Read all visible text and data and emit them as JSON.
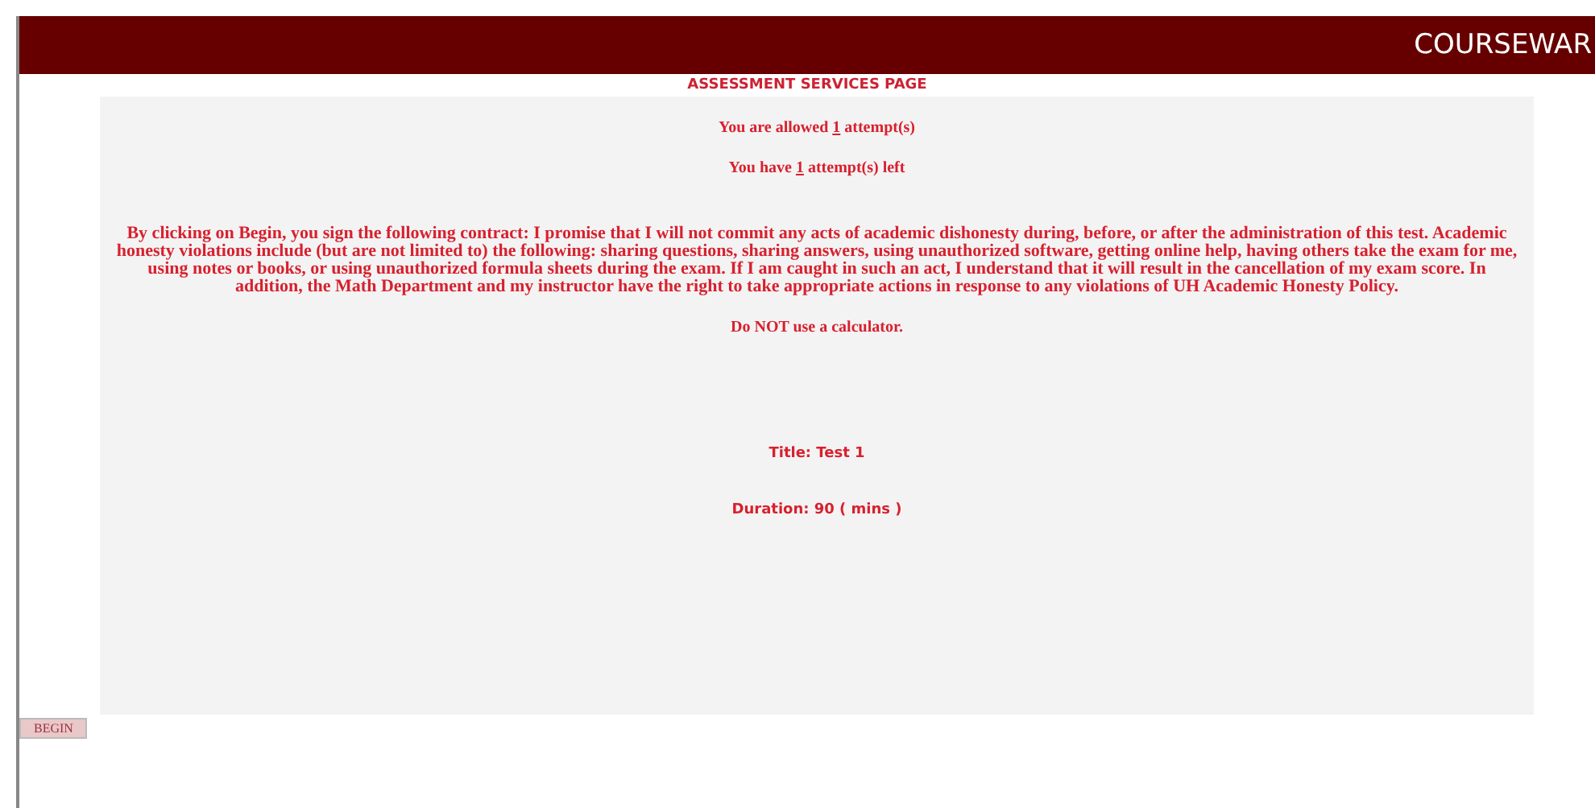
{
  "header": {
    "brand": "COURSEWAR"
  },
  "page_title": "ASSESSMENT SERVICES PAGE",
  "attempts_allowed": {
    "before": "You are allowed",
    "count": "1",
    "after": "attempt(s)"
  },
  "attempts_left": {
    "before": "You have",
    "count": "1",
    "after": "attempt(s) left"
  },
  "contract": "By clicking on Begin, you sign the following contract: I promise that I will not commit any acts of academic dishonesty during, before, or after the administration of this test. Academic honesty violations include (but are not limited to) the following: sharing questions, sharing answers, using unauthorized software, getting online help, having others take the exam for me, using notes or books, or using unauthorized formula sheets during the exam. If I am caught in such an act, I understand that it will result in the cancellation of my exam score. In addition, the Math Department and my instructor have the right to take appropriate actions in response to any violations of UH Academic Honesty Policy.",
  "calculator_note": "Do NOT use a calculator.",
  "test_title": "Title: Test 1",
  "duration": "Duration: 90 ( mins )",
  "begin_button": "BEGIN"
}
